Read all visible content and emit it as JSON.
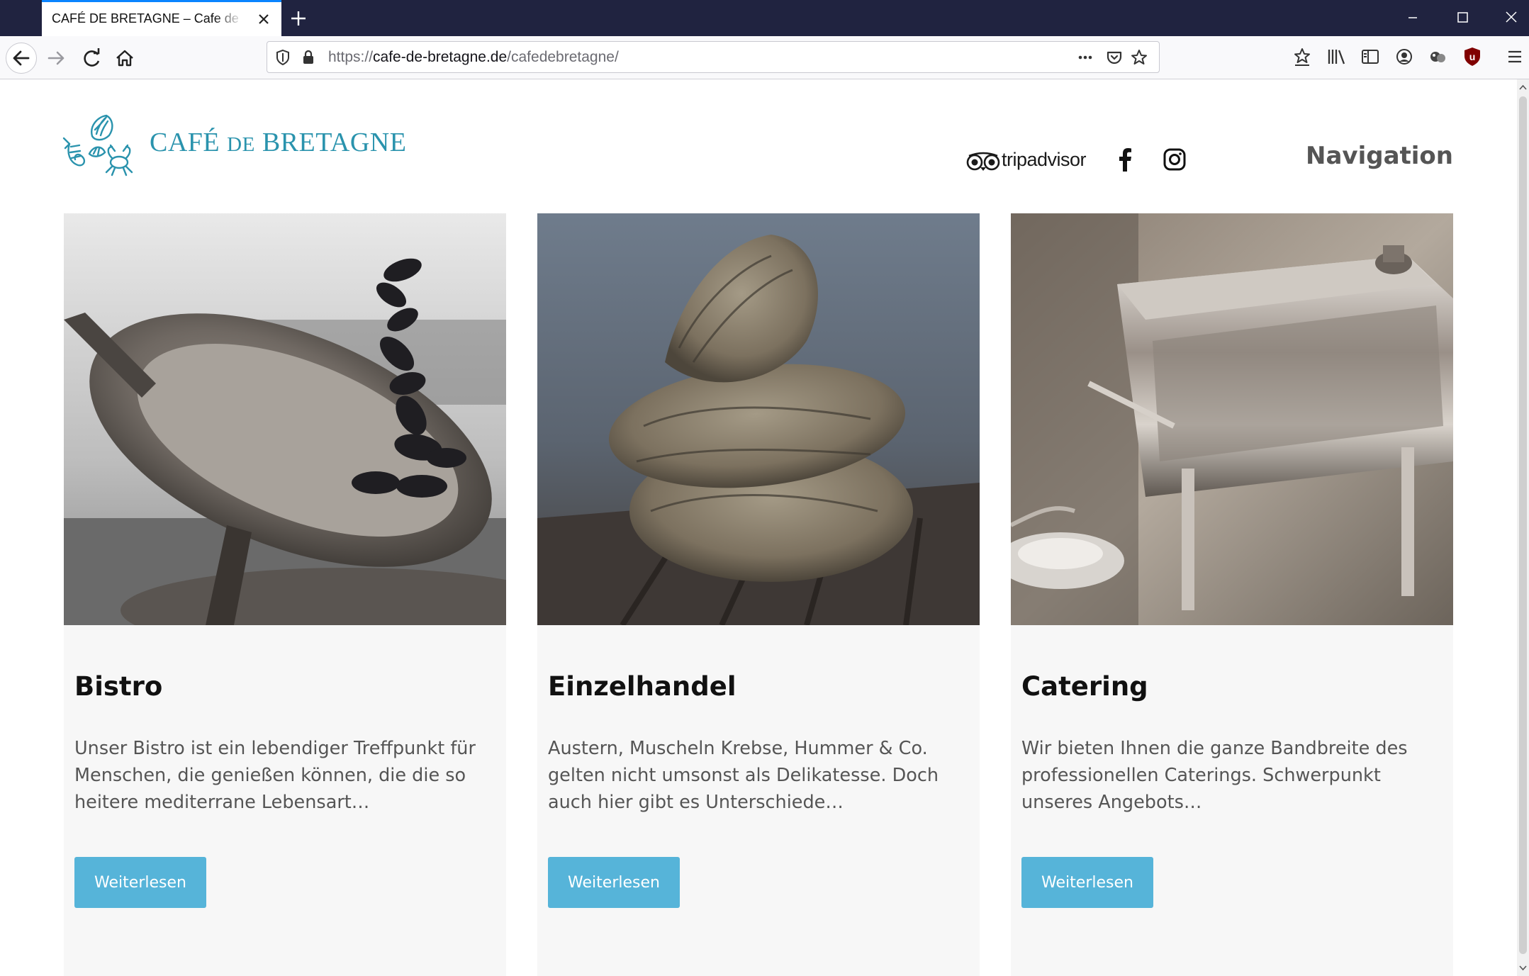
{
  "browser": {
    "tab_title": "CAFÉ DE BRETAGNE – Cafe de Bretagne",
    "url_prefix": "https://",
    "url_host": "cafe-de-bretagne.de",
    "url_path": "/cafedebretagne/"
  },
  "header": {
    "logo_main": "CAFÉ ",
    "logo_de": "DE",
    "logo_end": " BRETAGNE",
    "tripadvisor_label": "tripadvisor",
    "nav_label": "Navigation"
  },
  "cards": [
    {
      "title": "Bistro",
      "text": "Unser Bistro ist ein lebendiger Treffpunkt für Menschen, die genießen können, die die so heitere mediterrane Lebensart…",
      "button": "Weiterlesen"
    },
    {
      "title": "Einzelhandel",
      "text": "Austern, Muscheln Krebse, Hummer & Co. gelten nicht umsonst als Delikatesse. Doch auch hier gibt es Unterschiede…",
      "button": "Weiterlesen"
    },
    {
      "title": "Catering",
      "text": "Wir bieten Ihnen die ganze Bandbreite des professionellen Caterings. Schwerpunkt unseres Angebots…",
      "button": "Weiterlesen"
    }
  ],
  "colors": {
    "brand": "#2a93ad",
    "button": "#56b4d9",
    "tabbar": "#202340"
  }
}
